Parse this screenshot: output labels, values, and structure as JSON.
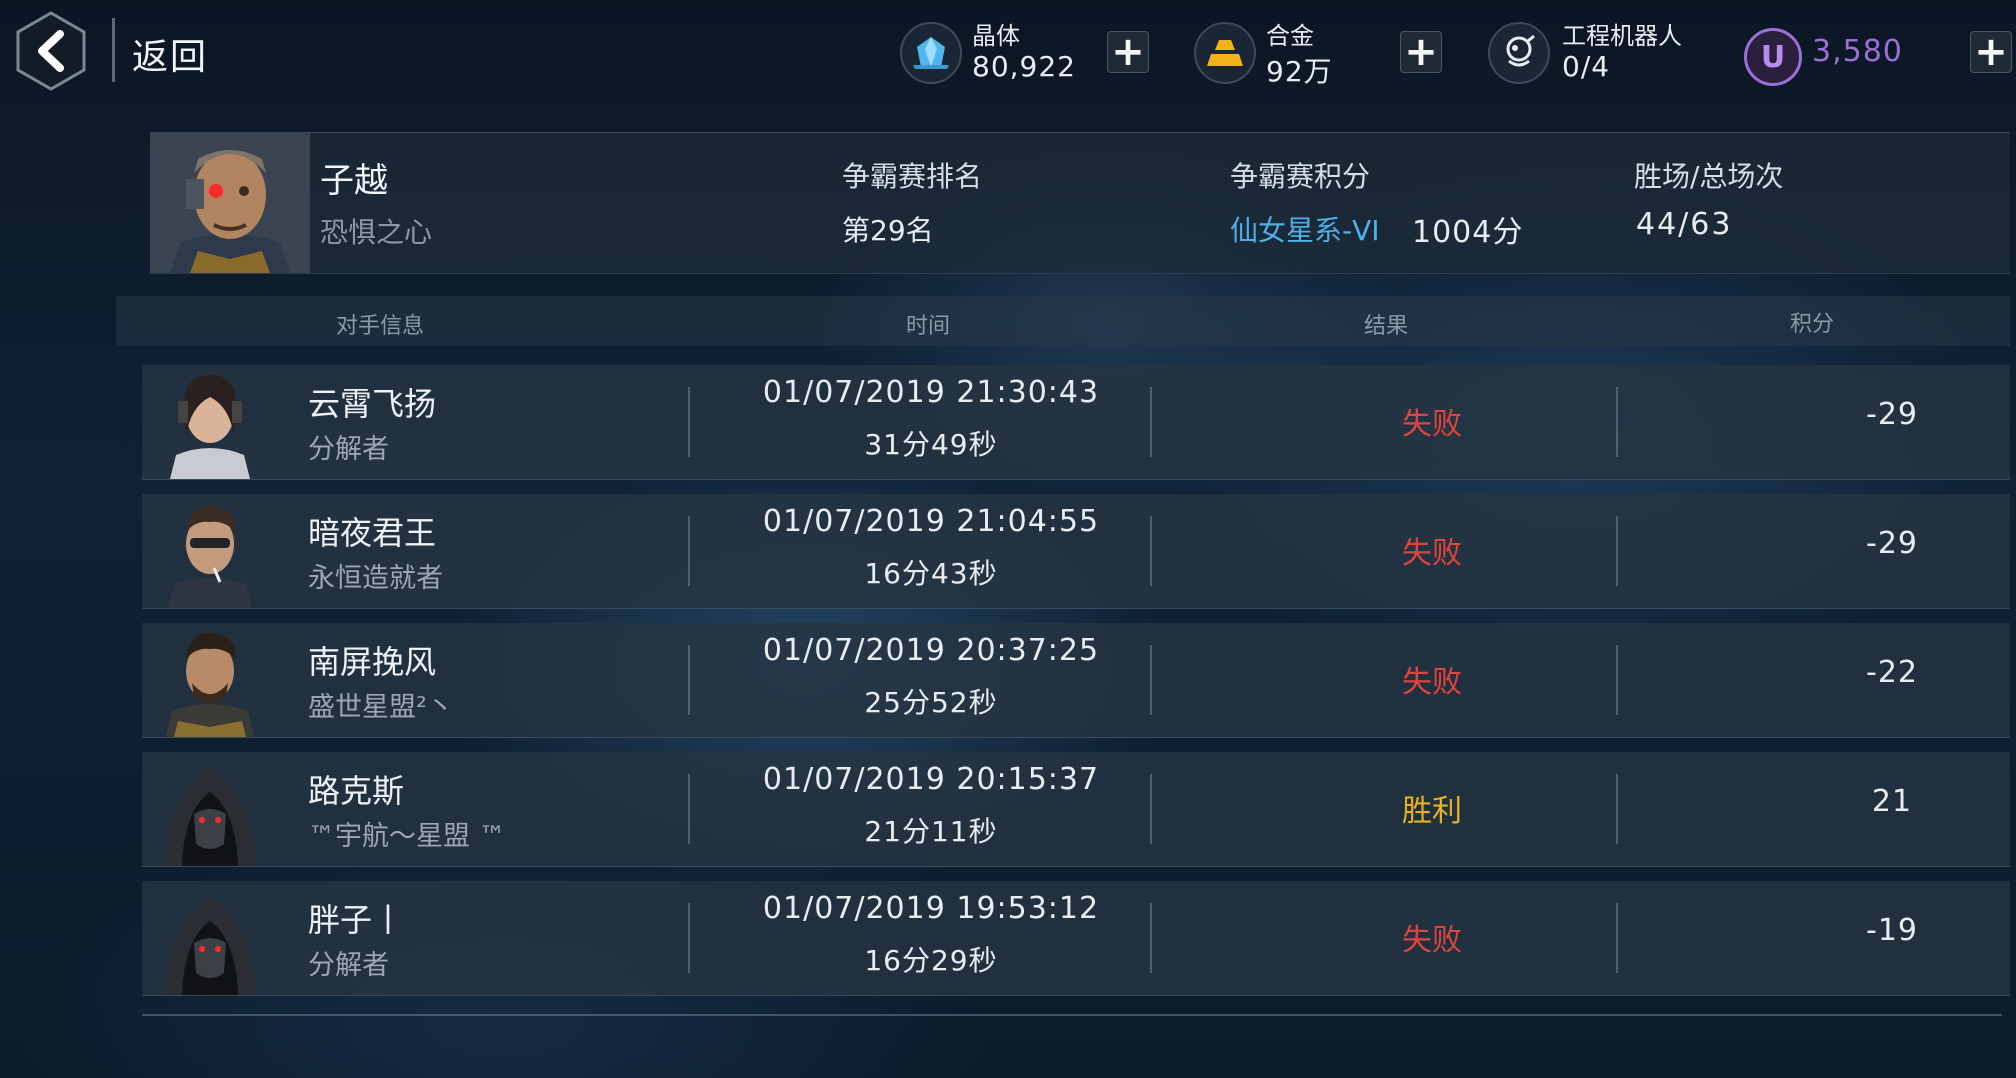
{
  "header": {
    "back_label": "返回",
    "resources": [
      {
        "name": "晶体",
        "value": "80,922",
        "icon": "crystal-icon"
      },
      {
        "name": "合金",
        "value": "92万",
        "icon": "alloy-icon"
      },
      {
        "name": "工程机器人",
        "value": "0/4",
        "icon": "robot-icon"
      }
    ],
    "u_currency": {
      "value": "3,580",
      "icon_letter": "U",
      "color": "#9b6fd6"
    }
  },
  "player": {
    "name": "子越",
    "title": "恐惧之心",
    "rank_label": "争霸赛排名",
    "rank_value": "第29名",
    "score_label": "争霸赛积分",
    "score_league": "仙女星系-VI",
    "score_value": "1004分",
    "record_label": "胜场/总场次",
    "record_value": "44/63"
  },
  "table": {
    "headers": [
      "对手信息",
      "时间",
      "结果",
      "积分"
    ],
    "rows": [
      {
        "name": "云霄飞扬",
        "title": "分解者",
        "time": "01/07/2019 21:30:43",
        "duration": "31分49秒",
        "result": "失败",
        "score": "-29"
      },
      {
        "name": "暗夜君王",
        "title": "永恒造就者",
        "time": "01/07/2019 21:04:55",
        "duration": "16分43秒",
        "result": "失败",
        "score": "-29"
      },
      {
        "name": "南屏挽风",
        "title": "盛世星盟²丶",
        "time": "01/07/2019 20:37:25",
        "duration": "25分52秒",
        "result": "失败",
        "score": "-22"
      },
      {
        "name": "路克斯",
        "title": "™宇航～星盟 ™",
        "time": "01/07/2019 20:15:37",
        "duration": "21分11秒",
        "result": "胜利",
        "score": "21"
      },
      {
        "name": "胖子丨",
        "title": "分解者",
        "time": "01/07/2019 19:53:12",
        "duration": "16分29秒",
        "result": "失败",
        "score": "-19"
      }
    ]
  },
  "colors": {
    "loss": "#e0443c",
    "win": "#e8b21e",
    "league": "#4fb0e8"
  }
}
